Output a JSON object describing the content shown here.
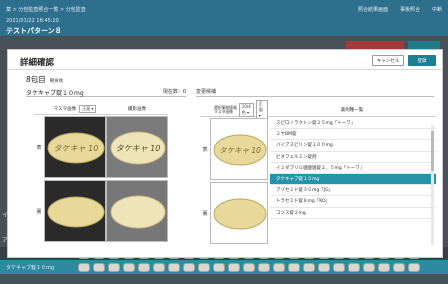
{
  "background": {
    "breadcrumb": "薬 > 分包監査照合一覧 > 分包監査",
    "top_right": [
      "照合結果画面",
      "事後照合",
      "中断"
    ],
    "date": "2021/01/22 18:45:20",
    "info": "テストパターン８",
    "rows": [
      {
        "label": ""
      },
      {
        "label": "タケキャブ錠１０mg"
      }
    ],
    "side_labels": [
      "イ",
      "ア"
    ]
  },
  "modal": {
    "title": "詳細確認",
    "cancel_label": "キャンセル",
    "ok_label": "登録",
    "pack_number": "8包目",
    "pack_time": "朝食後",
    "drug_name": "タケキャブ錠１０mg",
    "count": "現在数：0",
    "change_label": "変更候補",
    "left_table": {
      "col_master": "マスタ画像",
      "col_master_select": "正面",
      "col_captured": "撮影画像",
      "row_front": "表",
      "row_back": "裏"
    },
    "right_table": {
      "col_selected_title": "選択薬剤情報\nマスタ画像",
      "select_a": "10/4色",
      "select_b": "正面",
      "col_list": "薬剤種一覧",
      "row_front": "表",
      "row_back": "裏",
      "drug_list": [
        "スピロノラクトン錠２５mg「トーワ」",
        "ミヤBM錠",
        "バイアスピリン錠１００mg",
        "ビオフェルミン錠剤",
        "イミダプリル塩酸塩錠２．５mg「トーワ」",
        "タケキャブ錠１０mg",
        "アゾセミド錠３０mg「JG」",
        "トラセミド錠８mg「KO」",
        "コソス錠２mg"
      ],
      "selected_index": 5
    },
    "tablet_imprint": "タケキャブ 10"
  }
}
